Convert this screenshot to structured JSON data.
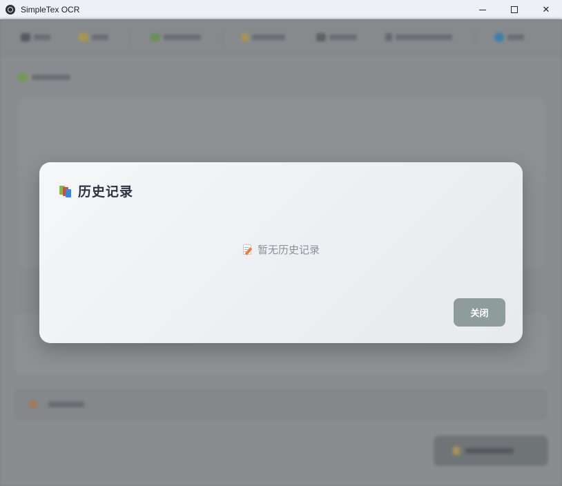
{
  "window": {
    "title": "SimpleTex OCR",
    "controls": {
      "minimize": "",
      "maximize": "",
      "close": "✕"
    }
  },
  "dialog": {
    "title": "历史记录",
    "empty_text": "暂无历史记录",
    "close_label": "关闭"
  },
  "colors": {
    "close_button": "#8f9c9c",
    "dialog_title": "#2b3240",
    "empty_text": "#8a9097"
  }
}
